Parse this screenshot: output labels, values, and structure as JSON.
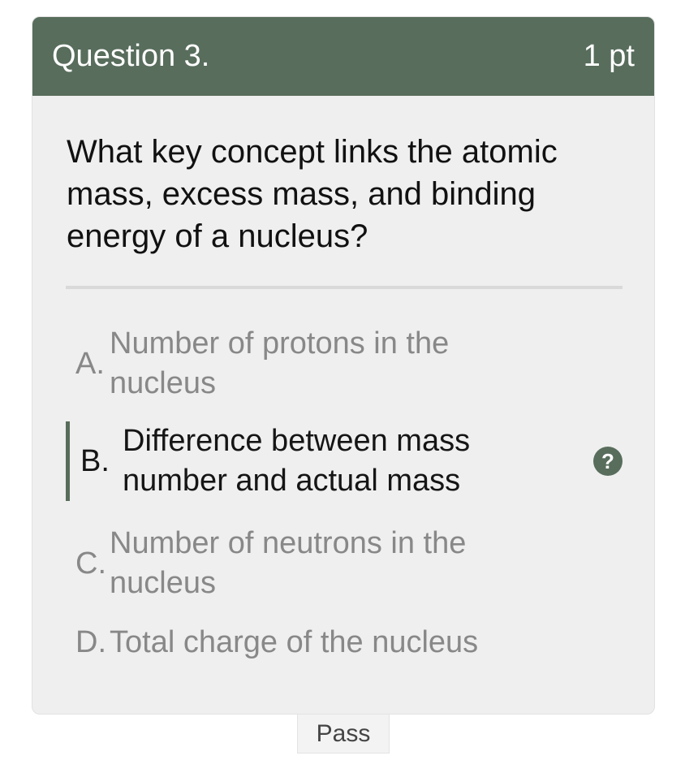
{
  "question": {
    "header_title": "Question 3.",
    "points": "1 pt",
    "text": "What key concept links the atomic mass, excess mass, and binding energy of a nucleus?"
  },
  "options": [
    {
      "letter": "A.",
      "text": "Number of protons in the nucleus",
      "selected": false
    },
    {
      "letter": "B.",
      "text": "Difference between mass number and actual mass",
      "selected": true
    },
    {
      "letter": "C.",
      "text": "Number of neutrons in the nucleus",
      "selected": false
    },
    {
      "letter": "D.",
      "text": "Total charge of the nucleus",
      "selected": false
    }
  ],
  "help_icon": {
    "symbol": "?",
    "icon": "question-mark-icon"
  },
  "actions": {
    "pass_label": "Pass"
  },
  "colors": {
    "header_bg": "#586d5c",
    "card_bg": "#efefef",
    "selected_text": "#151515",
    "unselected_text": "#888888"
  }
}
